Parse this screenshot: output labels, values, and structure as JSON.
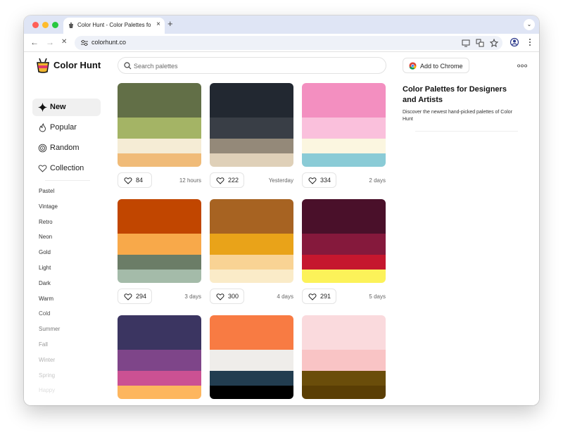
{
  "browser": {
    "tab_title": "Color Hunt - Color Palettes for Designers and Artists",
    "url": "colorhunt.co",
    "new_tab_symbol": "+",
    "close_symbol": "×",
    "back_symbol": "←",
    "forward_symbol": "→",
    "stop_symbol": "✕",
    "menu_symbol": "⌄"
  },
  "header": {
    "logo_text": "Color Hunt",
    "search_placeholder": "Search palettes",
    "add_to_chrome": "Add to Chrome"
  },
  "sidebar": {
    "nav": [
      {
        "label": "New",
        "icon": "sparkle-icon",
        "active": true
      },
      {
        "label": "Popular",
        "icon": "flame-icon",
        "active": false
      },
      {
        "label": "Random",
        "icon": "swirl-icon",
        "active": false
      },
      {
        "label": "Collection",
        "icon": "heart-icon",
        "active": false
      }
    ],
    "tags": [
      {
        "label": "Pastel",
        "color": "#333333"
      },
      {
        "label": "Vintage",
        "color": "#333333"
      },
      {
        "label": "Retro",
        "color": "#333333"
      },
      {
        "label": "Neon",
        "color": "#333333"
      },
      {
        "label": "Gold",
        "color": "#333333"
      },
      {
        "label": "Light",
        "color": "#333333"
      },
      {
        "label": "Dark",
        "color": "#333333"
      },
      {
        "label": "Warm",
        "color": "#333333"
      },
      {
        "label": "Cold",
        "color": "#555555"
      },
      {
        "label": "Summer",
        "color": "#777777"
      },
      {
        "label": "Fall",
        "color": "#999999"
      },
      {
        "label": "Winter",
        "color": "#b0b0b0"
      },
      {
        "label": "Spring",
        "color": "#c8c8c8"
      },
      {
        "label": "Happy",
        "color": "#dedede"
      }
    ]
  },
  "palettes": [
    {
      "colors": [
        "#626f47",
        "#a4b465",
        "#f5ecd5",
        "#f0bb78"
      ],
      "likes": "84",
      "age": "12 hours"
    },
    {
      "colors": [
        "#222831",
        "#393e46",
        "#948979",
        "#dfd0b8"
      ],
      "likes": "222",
      "age": "Yesterday"
    },
    {
      "colors": [
        "#f38fc0",
        "#fac0dc",
        "#fbf6e0",
        "#8acbd6"
      ],
      "likes": "334",
      "age": "2 days"
    },
    {
      "colors": [
        "#c14600",
        "#f8a94a",
        "#6b7d67",
        "#a4bba9"
      ],
      "likes": "294",
      "age": "3 days"
    },
    {
      "colors": [
        "#a76322",
        "#e9a319",
        "#f9d394",
        "#faebc8"
      ],
      "likes": "300",
      "age": "4 days"
    },
    {
      "colors": [
        "#4a102a",
        "#85193c",
        "#c5172e",
        "#fcf259"
      ],
      "likes": "291",
      "age": "5 days"
    },
    {
      "colors": [
        "#3b3561",
        "#7e4589",
        "#cb5193",
        "#fdb65e"
      ],
      "likes": null,
      "age": null
    },
    {
      "colors": [
        "#f87b43",
        "#efedea",
        "#223d50",
        "#000000"
      ],
      "likes": null,
      "age": null
    },
    {
      "colors": [
        "#fadadd",
        "#f9c4c5",
        "#6a4d0a",
        "#5a3e04"
      ],
      "likes": null,
      "age": null
    }
  ],
  "info": {
    "title": "Color Palettes for Designers and Artists",
    "subtitle": "Discover the newest hand-picked palettes of Color Hunt"
  }
}
